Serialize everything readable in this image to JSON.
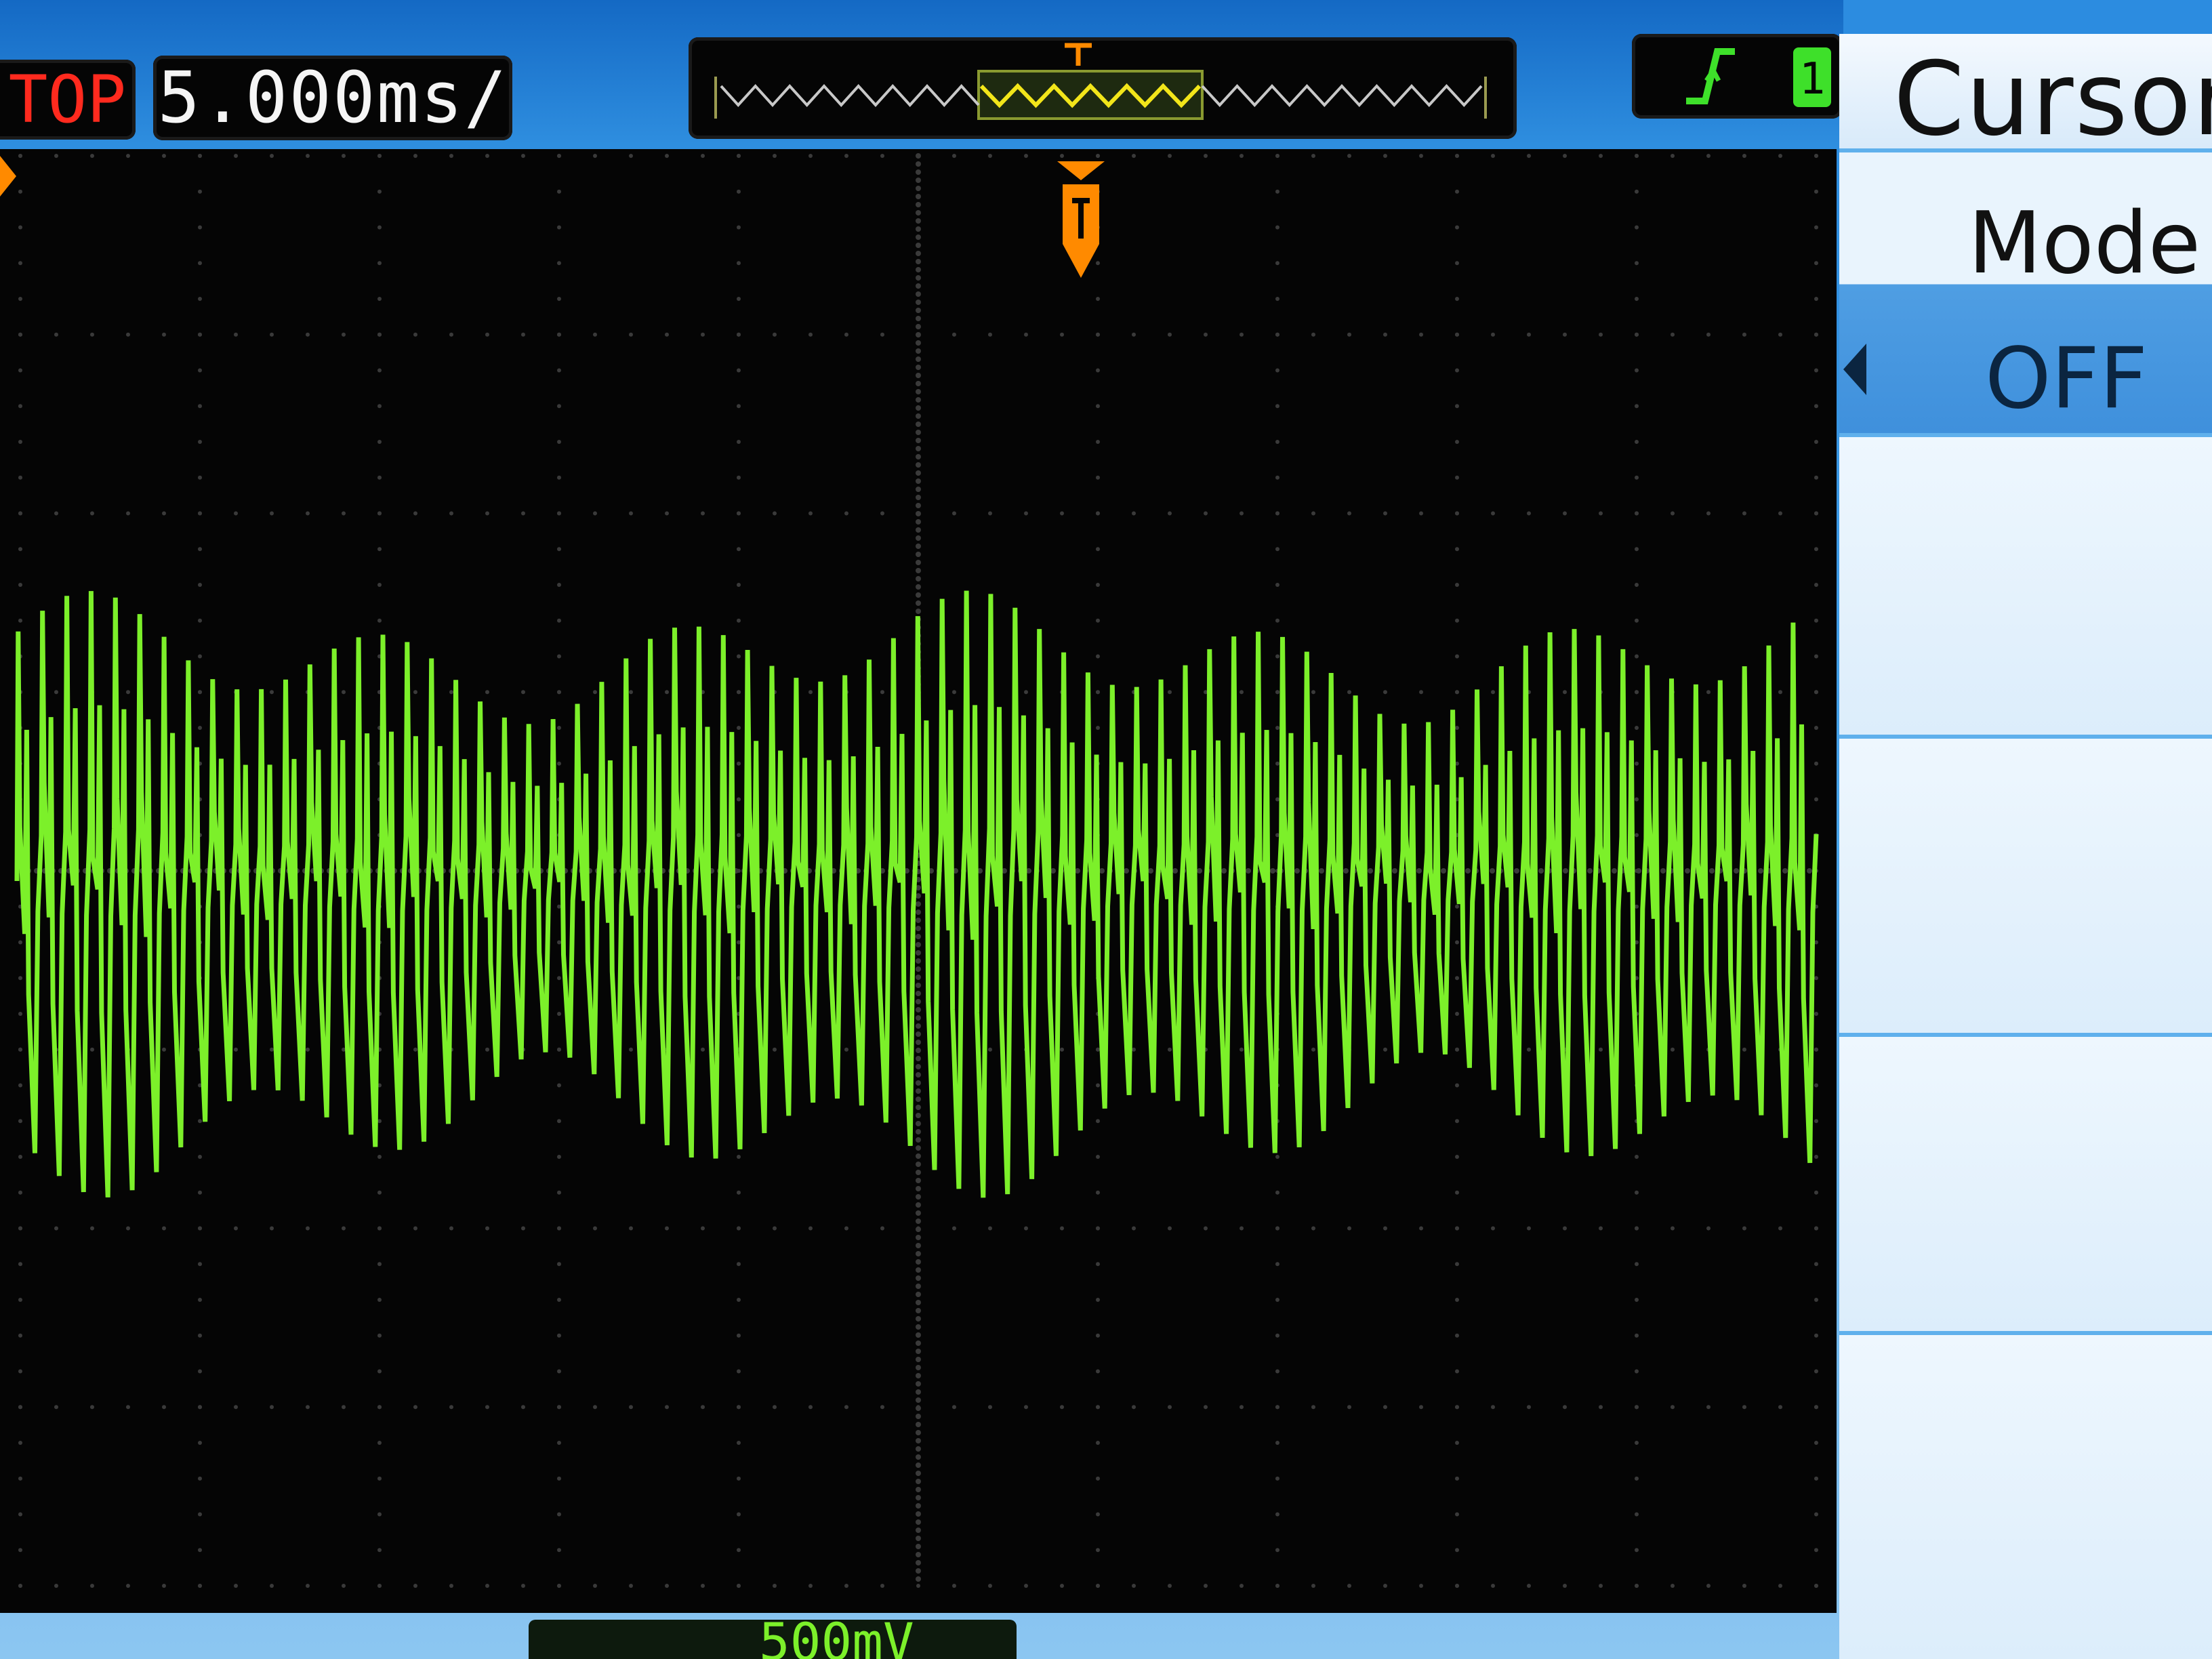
{
  "status_bar": {
    "run_state": "TOP",
    "timebase": "5.000ms/"
  },
  "menu": {
    "title": "Cursors",
    "mode_label": "Mode",
    "mode_value": "OFF"
  },
  "channel_readout": {
    "coupling": "",
    "scale": "500mV"
  },
  "colors": {
    "trace": "#7cf02a",
    "trigger_marker": "#ff8a00",
    "run_state": "#ff2a1e",
    "grid": "#3a3a3a",
    "menu_highlight": "#3f90dc"
  },
  "icons": {
    "edge": "rising-edge-icon",
    "channel": "channel1-icon",
    "trigger_position": "trigger-position-icon"
  }
}
